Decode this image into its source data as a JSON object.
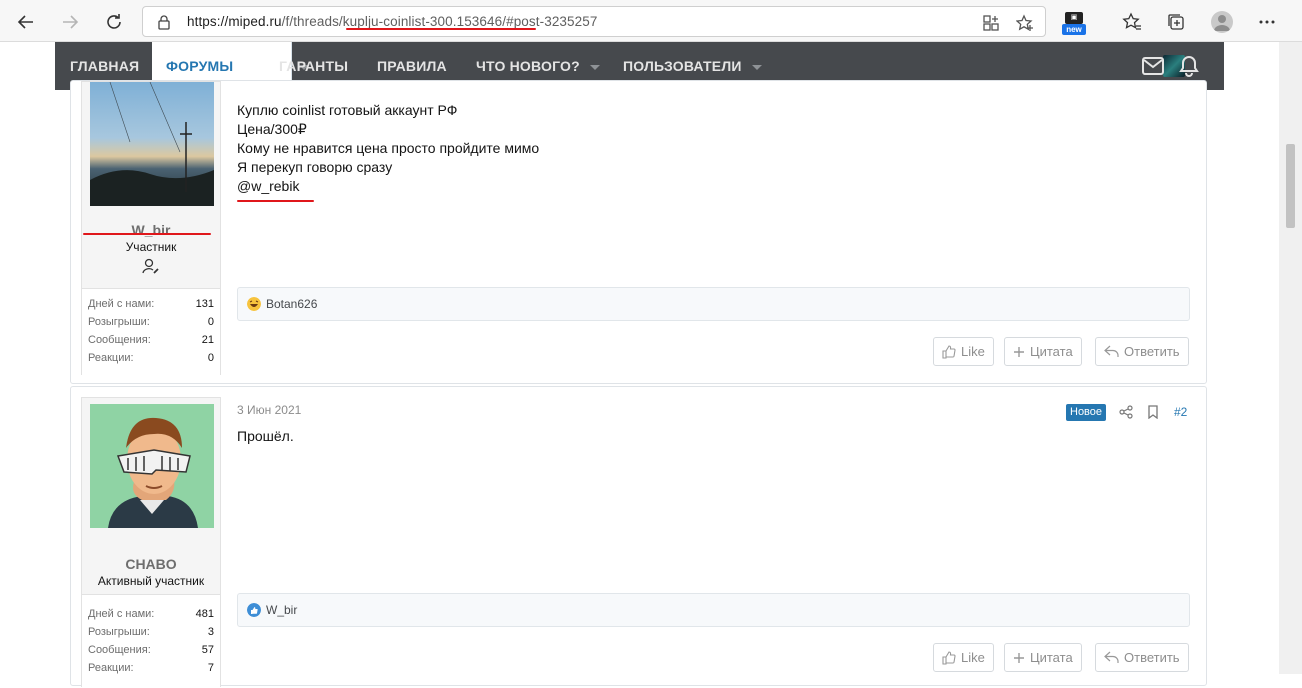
{
  "browser": {
    "url_host": "https://miped.ru",
    "url_path": "/f/threads/kuplju-coinlist-300.153646/#post-3235257",
    "ext_label": "new"
  },
  "nav": {
    "items": [
      {
        "label": "ГЛАВНАЯ"
      },
      {
        "label": "ФОРУМЫ"
      },
      {
        "label": "ГАРАНТЫ"
      },
      {
        "label": "ПРАВИЛА"
      },
      {
        "label": "ЧТО НОВОГО?"
      },
      {
        "label": "ПОЛЬЗОВАТЕЛИ"
      }
    ]
  },
  "posts": [
    {
      "username": "W_bir",
      "user_title": "Участник",
      "stats": [
        {
          "label": "Дней с нами:",
          "value": "131"
        },
        {
          "label": "Розыгрыши:",
          "value": "0"
        },
        {
          "label": "Сообщения:",
          "value": "21"
        },
        {
          "label": "Реакции:",
          "value": "0"
        }
      ],
      "message_lines": [
        "Куплю coinlist готовый аккаунт РФ",
        "Цена/300₽",
        "Кому не нравится цена просто пройдите мимо",
        "Я перекуп говорю сразу",
        "@w_rebik"
      ],
      "reaction_user": "Botan626",
      "actions": {
        "like": "Like",
        "quote": "Цитата",
        "reply": "Ответить"
      }
    },
    {
      "username": "CHABO",
      "user_title": "Активный участник",
      "date": "3 Июн 2021",
      "badge": "Новое",
      "post_number": "#2",
      "stats": [
        {
          "label": "Дней с нами:",
          "value": "481"
        },
        {
          "label": "Розыгрыши:",
          "value": "3"
        },
        {
          "label": "Сообщения:",
          "value": "57"
        },
        {
          "label": "Реакции:",
          "value": "7"
        }
      ],
      "message_lines": [
        "Прошёл."
      ],
      "reaction_user": "W_bir",
      "actions": {
        "like": "Like",
        "quote": "Цитата",
        "reply": "Ответить"
      }
    }
  ],
  "colors": {
    "accent": "#2577b1",
    "nav_bg": "#46494d",
    "highlight": "#e0171b"
  }
}
